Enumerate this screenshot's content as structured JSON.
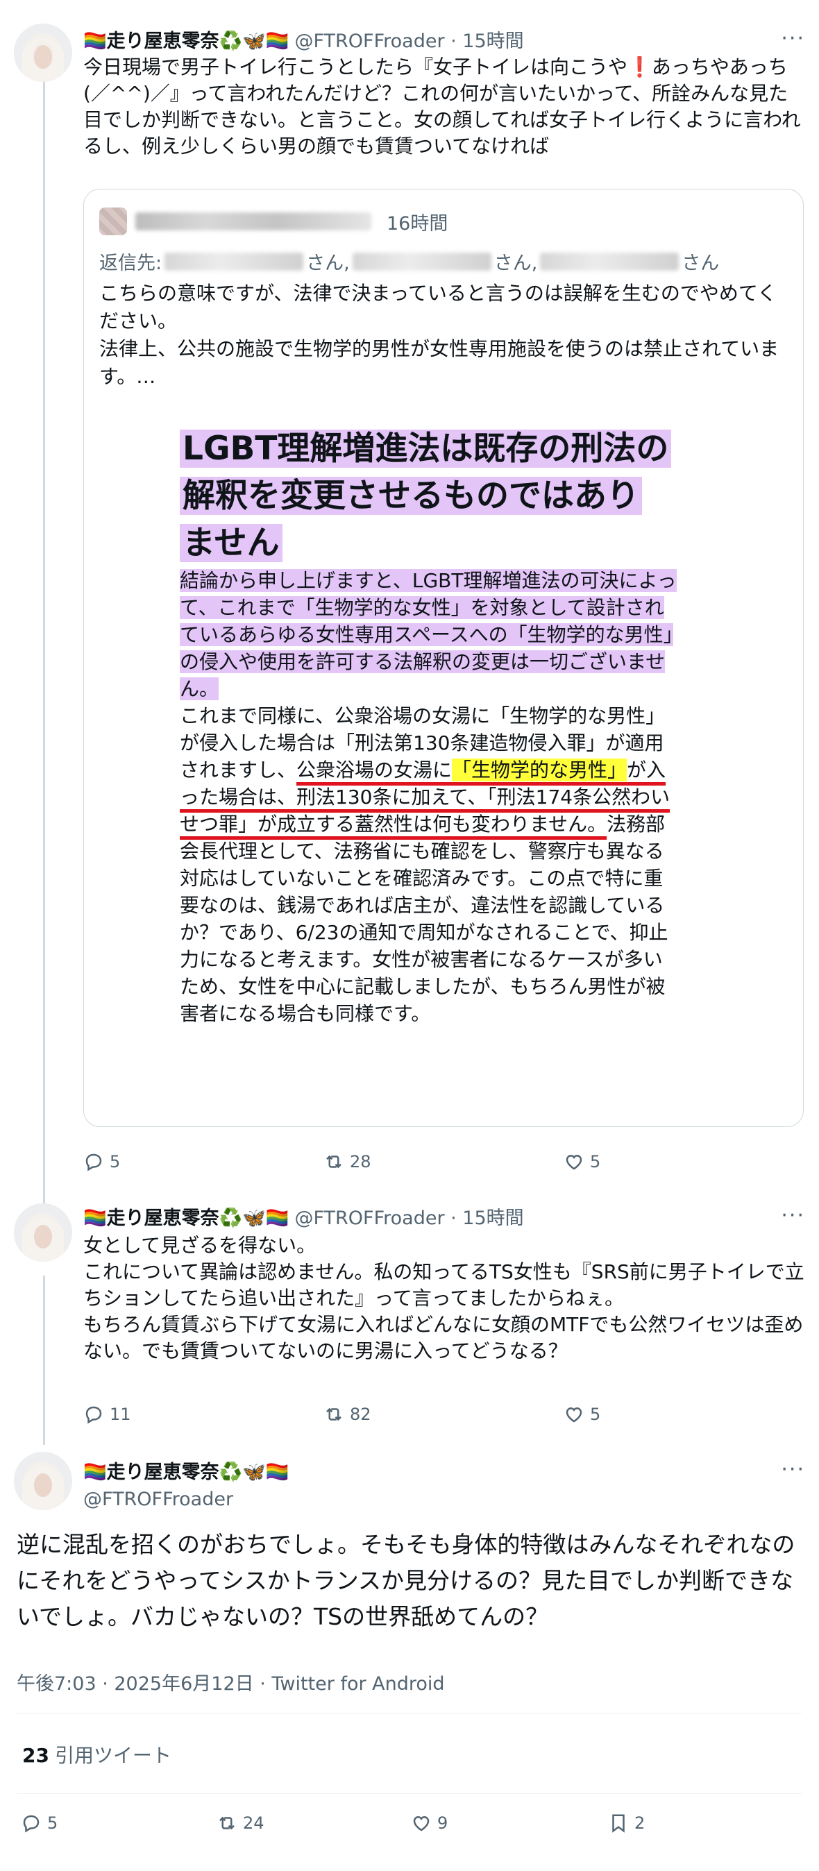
{
  "user": {
    "name": "🏳️‍🌈走り屋恵零奈♻️🦋🏳️‍🌈",
    "name_text": "走り屋恵零奈",
    "handle": "@FTROFFroader",
    "handle_line": "@FTROFFroader · 15時間"
  },
  "tweet1": {
    "header_suffix": "@FTROFFroader · 15時間",
    "text": "今日現場で男子トイレ行こうとしたら『女子トイレは向こうや❗あっちやあっち(／^^)／』って言われたんだけど？これの何が言いたいかって、所詮みんな見た目でしか判断できない。と言うこと。女の顔してれば女子トイレ行くように言われるし、例え少しくらい男の顔でも賃賃ついてなければ",
    "quote": {
      "time": "16時間",
      "replyto_label": "返信先:",
      "replyto_suffix": "さん,",
      "replyto_suffix_last": "さん",
      "text": "こちらの意味ですが、法律で決まっていると言うのは誤解を生むのでやめてください。\n法律上、公共の施設で生物学的男性が女性専用施設を使うのは禁止されています。…",
      "image": {
        "title_line1": "LGBT理解増進法は既存の刑法の",
        "title_line2": "解釈を変更させるものではあり",
        "title_line3": "ません",
        "p1": "結論から申し上げますと、LGBT理解増進法の可決によって、これまで「生物学的な女性」を対象として設計されているあらゆる女性専用スペースへの「生物学的な男性」の侵入や使用を許可する法解釈の変更は一切ございません。",
        "p2a": "これまで同様に、公衆浴場の女湯に「生物学的な男性」が侵入した場合は「刑法第130条建造物侵入罪」が適用されますし、",
        "p2b": "公衆浴場の女湯に",
        "p2c": "「生物学的な男性」",
        "p2d": "が入った場合は、刑法130条に加えて、「刑法174条公然わいせつ罪」が成立する蓋然性は何も変わりません。",
        "p2e": "法務部会長代理として、法務省にも確認をし、警察庁も異なる対応はしていないことを確認済みです。この点で特に重要なのは、銭湯であれば店主が、違法性を認識しているか？であり、6/23の通知で周知がなされることで、抑止力になると考えます。女性が被害者になるケースが多いため、女性を中心に記載しましたが、もちろん男性が被害者になる場合も同様です。"
      }
    },
    "replies": "5",
    "retweets": "28",
    "likes": "5"
  },
  "tweet2": {
    "header_suffix": "@FTROFFroader · 15時間",
    "text": "女として見ざるを得ない。\nこれについて異論は認めません。私の知ってるTS女性も『SRS前に男子トイレで立ちションしてたら追い出された』って言ってましたからねぇ。\nもちろん賃賃ぶら下げて女湯に入ればどんなに女顔のMTFでも公然ワイセツは歪めない。でも賃賃ついてないのに男湯に入ってどうなる？",
    "replies": "11",
    "retweets": "82",
    "likes": "5"
  },
  "main": {
    "text": "逆に混乱を招くのがおちでしょ。そもそも身体的特徴はみんなそれぞれなのにそれをどうやってシスかトランスか見分けるの？見た目でしか判断できないでしょ。バカじゃないの？TSの世界舐めてんの？",
    "meta": "午後7:03 · 2025年6月12日 · Twitter for Android",
    "quote_count": "23",
    "quote_label": "引用ツイート",
    "replies": "5",
    "retweets": "24",
    "likes": "9",
    "bookmarks": "2"
  },
  "more_label": "···",
  "colors": {
    "line": "#cfd9de",
    "secondary": "#536471",
    "highlight_purple": "#e3c5f7",
    "highlight_yellow": "#ffff3a",
    "underline_red": "#e0141e"
  }
}
